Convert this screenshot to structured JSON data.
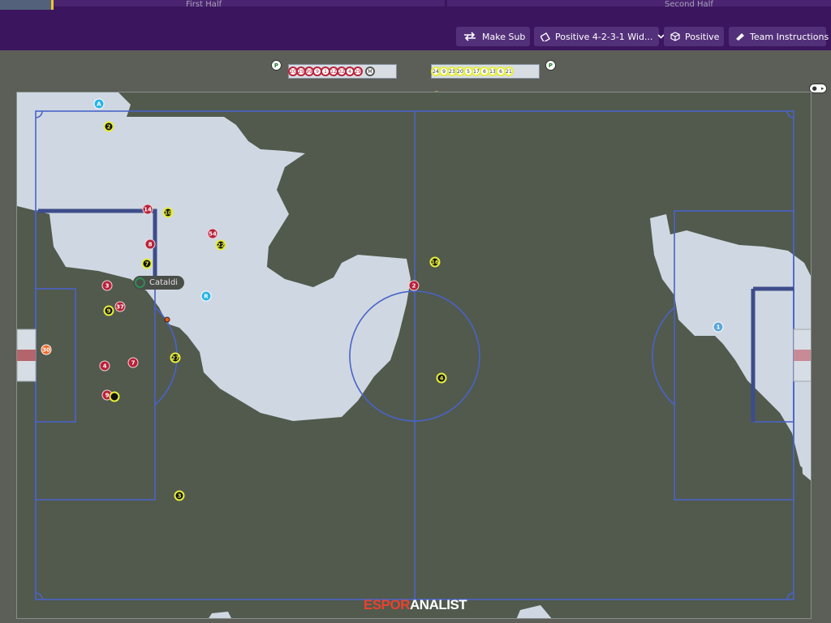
{
  "timeline": {
    "first_half_label": "First Half",
    "second_half_label": "Second Half"
  },
  "toolbar": {
    "make_sub_label": "Make Sub",
    "formation_label": "Positive 4-2-3-1 Wid...",
    "mentality_label": "Positive",
    "team_instructions_label": "Team Instructions"
  },
  "home_bench": {
    "tag": "P",
    "numbers": [
      "20",
      "29",
      "99",
      "9",
      "1",
      "12",
      "32",
      "4",
      "29"
    ],
    "manager_tag": "M"
  },
  "away_bench": {
    "tag": "P",
    "numbers": [
      "24",
      "9",
      "23",
      "20",
      "5",
      "17",
      "6",
      "13",
      "6",
      "21"
    ],
    "manager_tag": "M"
  },
  "players": {
    "home": [
      "14",
      "54",
      "8",
      "3",
      "37",
      "4",
      "7",
      "9",
      "2"
    ],
    "away": [
      "2",
      "10",
      "22",
      "7",
      "9",
      "27",
      "16",
      "4",
      "3"
    ],
    "home_keeper": "30",
    "away_keeper": "1",
    "referee_assistant_top": "A",
    "referee": "R"
  },
  "focused_player": {
    "name": "Cataldi"
  },
  "watermark": {
    "part1": "ESPOR",
    "part2": "ANALIST"
  },
  "colors": {
    "topbar": "#3b165f",
    "pitch": "#515a4d",
    "snow": "#cfd8e2",
    "lines": "#4a63c8",
    "home": "#b8213a",
    "away_ring": "#e6ee3a"
  }
}
